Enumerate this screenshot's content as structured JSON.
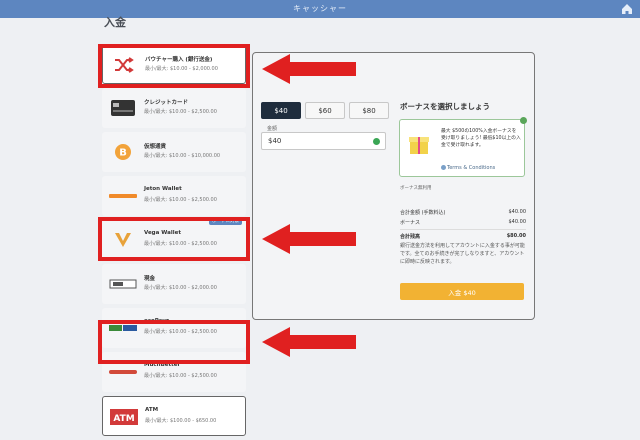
{
  "header": {
    "title": "キャッシャー",
    "page_heading_fragment": "入金"
  },
  "methods": [
    {
      "name": "バウチャー購入 (銀行送金)",
      "range": "最小/最大: $10.00 - $2,000.00",
      "logo": "shuffle-icon"
    },
    {
      "name": "クレジットカード",
      "range": "最小/最大: $10.00 - $2,500.00",
      "logo": "credit-card-icon"
    },
    {
      "name": "仮想通貨",
      "range": "最小/最大: $10.00 - $10,000.00",
      "logo": "bitcoin-icon"
    },
    {
      "name": "Jeton Wallet",
      "range": "最小/最大: $10.00 - $2,500.00",
      "logo": "jeton-icon"
    },
    {
      "name": "Vega Wallet",
      "range": "最小/最大: $10.00 - $2,500.00",
      "logo": "vega-icon",
      "badge": "ボーナス対象"
    },
    {
      "name": "現金",
      "range": "最小/最大: $10.00 - $2,000.00",
      "logo": "cash-icon"
    },
    {
      "name": "ecoPayz",
      "range": "最小/最大: $10.00 - $2,500.00",
      "logo": "ecopayz-icon"
    },
    {
      "name": "MuchBetter",
      "range": "最小/最大: $10.00 - $2,500.00",
      "logo": "muchbetter-icon"
    },
    {
      "name": "ATM",
      "range": "最小/最大: $100.00 - $650.00",
      "logo": "atm-icon"
    }
  ],
  "amounts": [
    "$40",
    "$60",
    "$80"
  ],
  "amount_field": {
    "label": "金額",
    "value": "$40"
  },
  "bonus": {
    "title": "ボーナスを選択しましょう",
    "text": "最大 $500の100%入金ボーナスを受け取りましょう! 最低$10以上の入金で受け取れます。",
    "terms": "Terms & Conditions",
    "no_bonus": "ボーナス無利用"
  },
  "summary": {
    "rows": [
      {
        "label": "合計金額 (手数料込)",
        "value": "$40.00"
      },
      {
        "label": "ボーナス",
        "value": "$40.00"
      },
      {
        "label": "合計残高",
        "value": "$80.00"
      }
    ]
  },
  "note": "銀行送金方法を利用してアカウントに入金する事が可能です。全てのお手続きが完了しなりますと、アカウントに即時に反映されます。",
  "deposit_button": "入金 $40",
  "colors": {
    "topbar": "#5d86c0",
    "highlight": "#e02020",
    "button": "#f2b233"
  }
}
